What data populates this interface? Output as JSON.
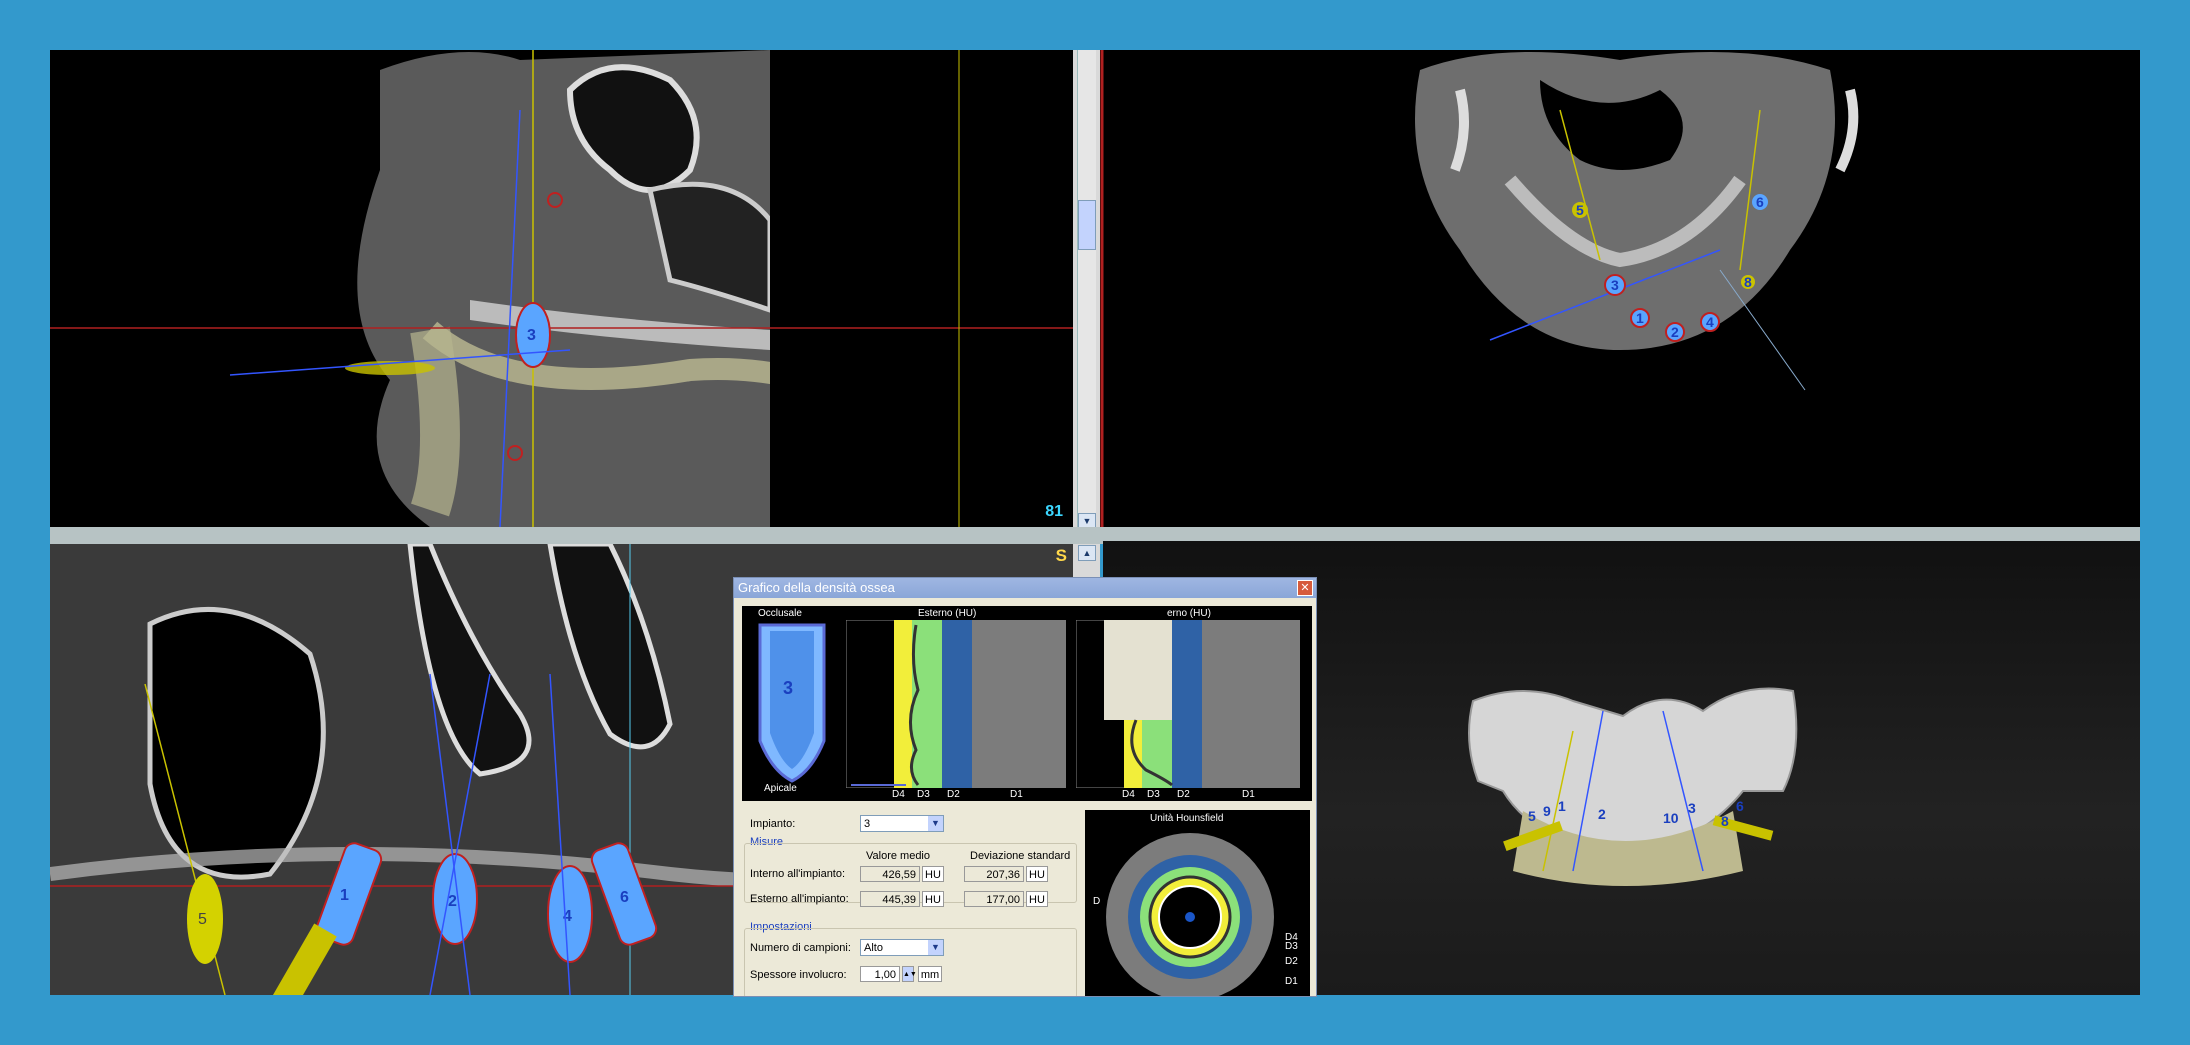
{
  "sagittal": {
    "slice_number": "81"
  },
  "panoramic": {
    "orientation_label": "S"
  },
  "dialog": {
    "title": "Grafico della densità ossea",
    "occlusal_label": "Occlusale",
    "apical_label": "Apicale",
    "implant_badge": "3",
    "external_hu_label": "Esterno (HU)",
    "internal_hu_label_partial": "erno (HU)",
    "density_classes": [
      "D4",
      "D3",
      "D2",
      "D1"
    ],
    "implant_label": "Impianto:",
    "implant_value": "3",
    "measures_title": "Misure",
    "col_mean": "Valore medio",
    "col_std": "Deviazione standard",
    "row_internal": "Interno all'impianto:",
    "row_external": "Esterno all'impianto:",
    "internal_mean": "426,59",
    "internal_std": "207,36",
    "external_mean": "445,39",
    "external_std": "177,00",
    "unit_hu": "HU",
    "settings_title": "Impostazioni",
    "samples_label": "Numero di campioni:",
    "samples_value": "Alto",
    "thickness_label": "Spessore involucro:",
    "thickness_value": "1,00",
    "thickness_unit": "mm",
    "hounsfield_title": "Unità Hounsfield",
    "ring_labels": [
      "D4",
      "D3",
      "D2",
      "D1"
    ],
    "ring_side_label": "D"
  },
  "axial": {
    "implant_labels": [
      "5",
      "3",
      "1",
      "2",
      "4",
      "6",
      "8"
    ]
  },
  "view3d": {
    "implant_labels": [
      "5",
      "9",
      "1",
      "2",
      "10",
      "3",
      "8",
      "6"
    ]
  }
}
